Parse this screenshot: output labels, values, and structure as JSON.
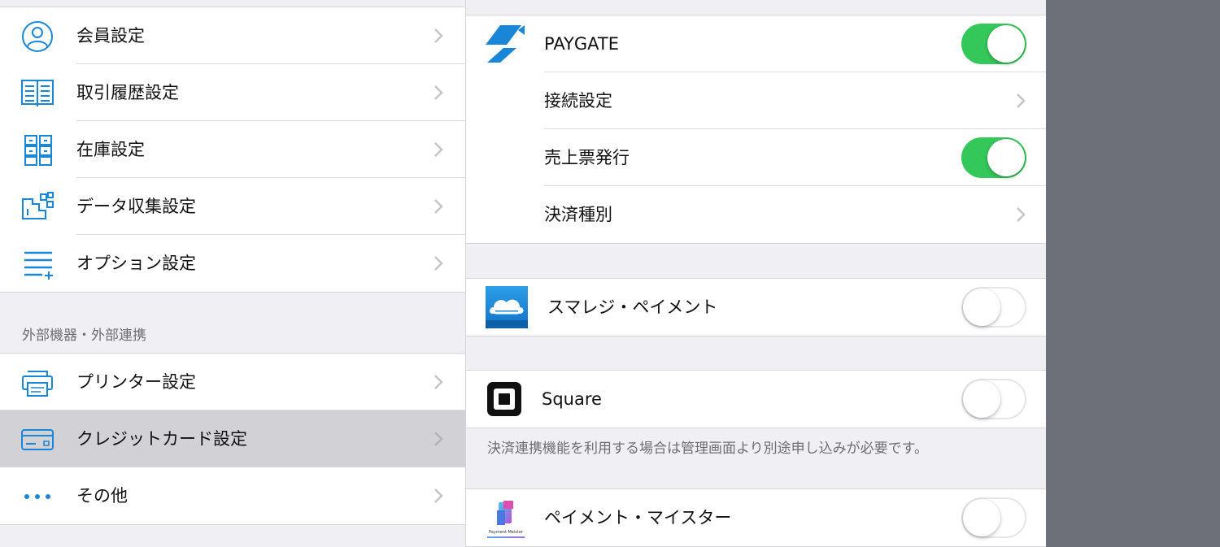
{
  "left_panel": {
    "items_top": [
      {
        "label": "会員設定",
        "icon": "person-circle-icon"
      },
      {
        "label": "取引履歴設定",
        "icon": "open-book-icon"
      },
      {
        "label": "在庫設定",
        "icon": "drawers-icon"
      },
      {
        "label": "データ収集設定",
        "icon": "data-nodes-icon"
      },
      {
        "label": "オプション設定",
        "icon": "list-plus-icon"
      }
    ],
    "section_header": "外部機器・外部連携",
    "items_external": [
      {
        "label": "プリンター設定",
        "icon": "printer-icon",
        "selected": false
      },
      {
        "label": "クレジットカード設定",
        "icon": "credit-card-icon",
        "selected": true
      },
      {
        "label": "その他",
        "icon": "ellipsis-icon",
        "selected": false
      }
    ]
  },
  "right_panel": {
    "paygate": {
      "label": "PAYGATE",
      "enabled": true,
      "icon": "paygate-logo-icon",
      "sub_items": [
        {
          "label": "接続設定",
          "type": "link"
        },
        {
          "label": "売上票発行",
          "type": "toggle",
          "enabled": true
        },
        {
          "label": "決済種別",
          "type": "link"
        }
      ]
    },
    "smaregi": {
      "label": "スマレジ・ペイメント",
      "enabled": false,
      "icon": "cloud-logo-icon"
    },
    "square": {
      "label": "Square",
      "enabled": false,
      "icon": "square-logo-icon"
    },
    "note": "決済連携機能を利用する場合は管理画面より別途申し込みが必要です。",
    "payment_meister": {
      "label": "ペイメント・マイスター",
      "enabled": false,
      "icon": "payment-meister-logo-icon",
      "logo_text": "Payment Meister"
    }
  },
  "colors": {
    "accent_blue": "#1a86d8",
    "toggle_on": "#34c759",
    "background": "#efeff4",
    "selected_row": "#d1d1d6"
  }
}
